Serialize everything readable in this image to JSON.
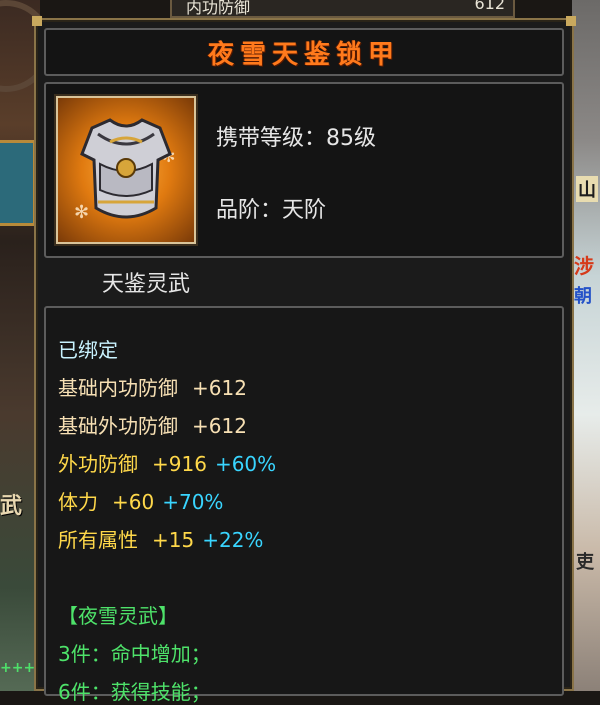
{
  "background": {
    "top_strip_label": "内功防御",
    "top_strip_value": "612",
    "left_text": "武",
    "left_plus": "+++",
    "right_signs": [
      "山",
      "涉",
      "朝",
      "吏"
    ]
  },
  "tooltip": {
    "title": "夜雪天鉴锁甲",
    "item_icon": "armor-breastplate-icon",
    "carry_level": "携带等级：85级",
    "grade": "品阶：天阶",
    "set_name_label": "天鉴灵武",
    "bound_status": "已绑定",
    "stats": [
      {
        "name": "基础内功防御",
        "value": "+612",
        "bonus": ""
      },
      {
        "name": "基础外功防御",
        "value": "+612",
        "bonus": ""
      },
      {
        "name": "外功防御",
        "value": "+916",
        "bonus": "+60%"
      },
      {
        "name": "体力",
        "value": "+60",
        "bonus": "+70%"
      },
      {
        "name": "所有属性",
        "value": "+15",
        "bonus": "+22%"
      }
    ],
    "set_title": "【夜雪灵武】",
    "set_effects": [
      "3件：命中增加；",
      "6件：获得技能；"
    ]
  },
  "colors": {
    "title": "#ff7a1c",
    "bound": "#c9f3ff",
    "base_stat": "#f7e0b4",
    "stat_yellow": "#ffd84a",
    "bonus_cyan": "#39d5ff",
    "set_green": "#4ee36a",
    "frame_gold": "#8a7448"
  }
}
